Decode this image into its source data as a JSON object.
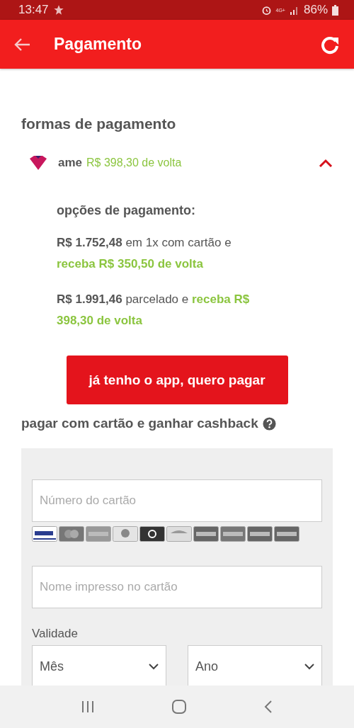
{
  "status_bar": {
    "time": "13:47",
    "network": "4G+",
    "battery": "86%"
  },
  "app_bar": {
    "title": "Pagamento"
  },
  "payment_methods": {
    "title": "formas de pagamento",
    "ame": {
      "name": "ame",
      "cashback": "R$ 398,30 de volta",
      "expanded": true,
      "options_title": "opções de pagamento:",
      "options": [
        {
          "amount": "R$ 1.752,48",
          "text": "em 1x com cartão e",
          "cashback": "receba R$ 350,50 de volta"
        },
        {
          "amount": "R$ 1.991,46",
          "text": "parcelado e",
          "cashback": "receba R$ 398,30 de volta"
        }
      ],
      "button": "já tenho o app, quero pagar"
    }
  },
  "card_payment": {
    "title": "pagar com cartão e ganhar cashback",
    "card_number": {
      "placeholder": "Número do cartão"
    },
    "card_brands": [
      {
        "kind": "visa"
      },
      {
        "kind": "mastercard"
      },
      {
        "kind": "amex"
      },
      {
        "kind": "diners"
      },
      {
        "kind": "elo"
      },
      {
        "kind": "aura"
      },
      {
        "kind": "hipercard"
      },
      {
        "kind": "jcb"
      },
      {
        "kind": "other"
      },
      {
        "kind": "other"
      }
    ],
    "card_name": {
      "placeholder": "Nome impresso no cartão"
    },
    "expiry": {
      "label": "Validade",
      "selects": [
        {
          "placeholder": "Mês"
        },
        {
          "placeholder": "Ano"
        }
      ]
    }
  }
}
